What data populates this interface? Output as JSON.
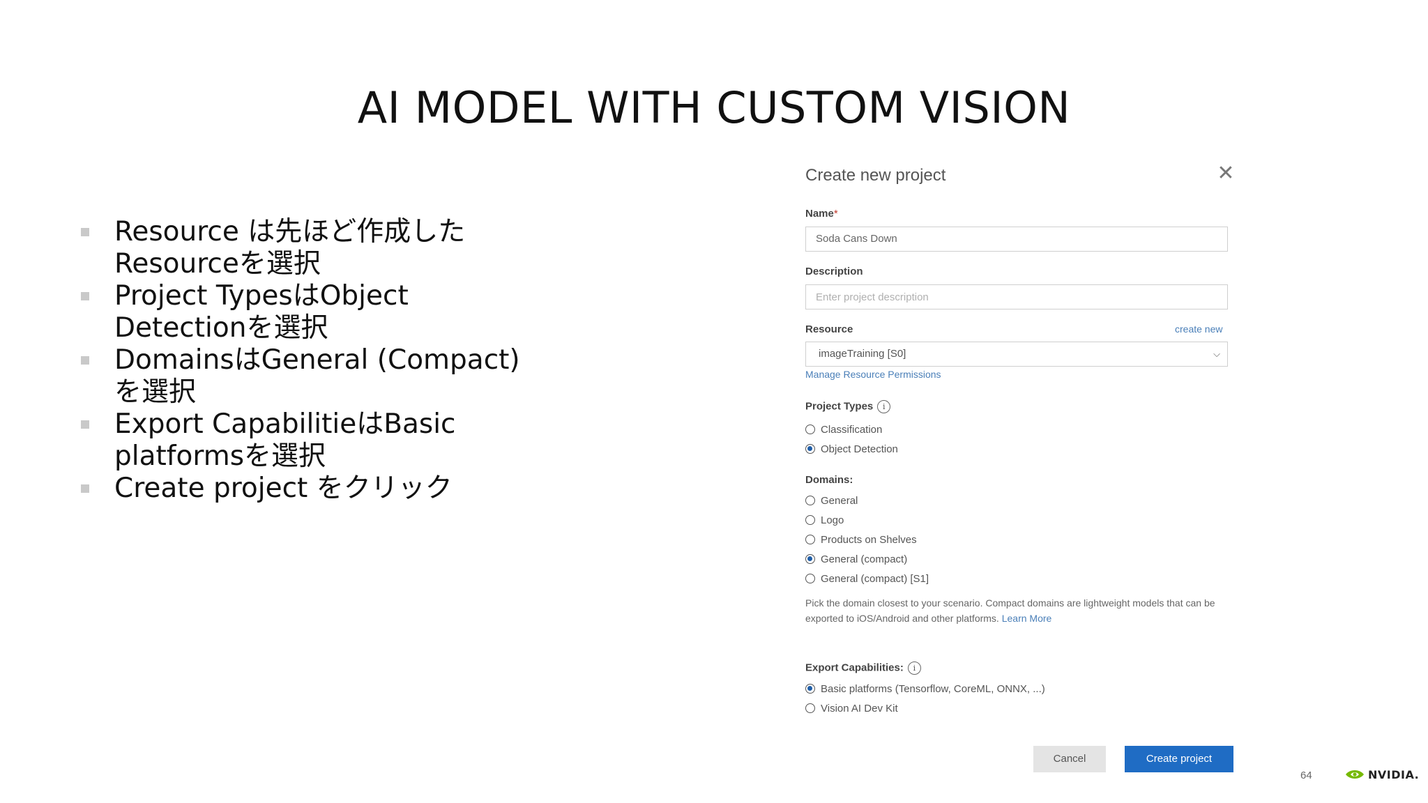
{
  "slide": {
    "title": "AI MODEL WITH CUSTOM VISION",
    "bullets": [
      [
        "Resource は先ほど作成した",
        "Resourceを選択"
      ],
      [
        "Project TypesはObject",
        "Detectionを選択"
      ],
      [
        "DomainsはGeneral (Compact)",
        "を選択"
      ],
      [
        "Export CapabilitieはBasic",
        "platformsを選択"
      ],
      [
        "Create project をクリック"
      ]
    ],
    "page_number": "64",
    "logo_text": "NVIDIA."
  },
  "dialog": {
    "title": "Create new project",
    "close_glyph": "✕",
    "name": {
      "label": "Name",
      "required_mark": "*",
      "value": "Soda Cans Down"
    },
    "description": {
      "label": "Description",
      "placeholder": "Enter project description"
    },
    "resource": {
      "label": "Resource",
      "create_new": "create new",
      "selected": "imageTraining [S0]",
      "manage_link": "Manage Resource Permissions"
    },
    "project_types": {
      "label": "Project Types",
      "options": [
        {
          "label": "Classification",
          "checked": false
        },
        {
          "label": "Object Detection",
          "checked": true
        }
      ]
    },
    "domains": {
      "label": "Domains:",
      "options": [
        {
          "label": "General",
          "checked": false
        },
        {
          "label": "Logo",
          "checked": false
        },
        {
          "label": "Products on Shelves",
          "checked": false
        },
        {
          "label": "General (compact)",
          "checked": true
        },
        {
          "label": "General (compact) [S1]",
          "checked": false
        }
      ],
      "help_text": "Pick the domain closest to your scenario. Compact domains are lightweight models that can be exported to iOS/Android and other platforms.",
      "learn_more": "Learn More"
    },
    "export_capabilities": {
      "label": "Export Capabilities:",
      "options": [
        {
          "label": "Basic platforms (Tensorflow, CoreML, ONNX, ...)",
          "checked": true
        },
        {
          "label": "Vision AI Dev Kit",
          "checked": false
        }
      ]
    },
    "buttons": {
      "cancel": "Cancel",
      "create": "Create project"
    }
  },
  "colors": {
    "primary_button": "#1f6cc4",
    "link": "#4a7fb8",
    "radio_checked": "#1f5ea8",
    "logo_green": "#76b900"
  },
  "icons": {
    "close": "close-icon",
    "info": "info-icon",
    "dropdown": "chevron-down-icon",
    "logo": "nvidia-logo-icon"
  }
}
